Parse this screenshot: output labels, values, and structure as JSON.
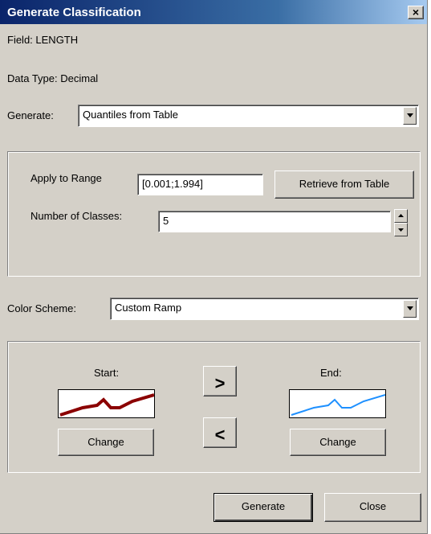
{
  "window": {
    "title": "Generate Classification",
    "close_glyph": "×"
  },
  "info": {
    "field": "Field: LENGTH",
    "data_type": "Data Type: Decimal"
  },
  "generate": {
    "label": "Generate:",
    "value": "Quantiles from Table"
  },
  "range": {
    "apply_label": "Apply to Range",
    "apply_value": "[0.001;1.994]",
    "retrieve_label": "Retrieve from Table",
    "classes_label": "Number of Classes:",
    "classes_value": "5"
  },
  "color_scheme": {
    "label": "Color Scheme:",
    "value": "Custom Ramp"
  },
  "ramp": {
    "start_label": "Start:",
    "end_label": "End:",
    "change_label": "Change",
    "forward_glyph": ">",
    "back_glyph": "<",
    "start_color": "#8b0000",
    "end_color": "#1e90ff"
  },
  "footer": {
    "generate_label": "Generate",
    "close_label": "Close"
  },
  "icons": {
    "close": "close-icon",
    "dropdown": "chevron-down-icon",
    "spin_up": "spin-up-icon",
    "spin_down": "spin-down-icon"
  }
}
